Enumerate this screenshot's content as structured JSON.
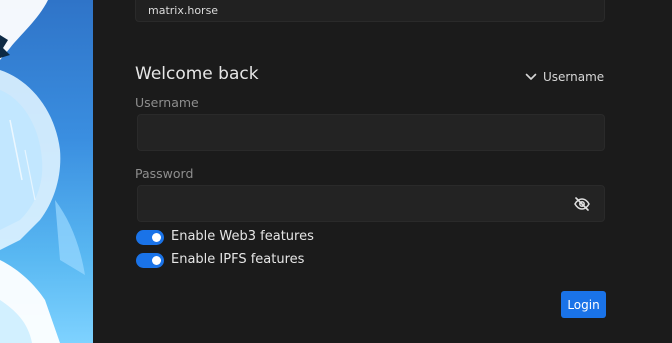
{
  "server": {
    "value": "matrix.horse"
  },
  "login": {
    "title": "Welcome back",
    "method_label": "Username",
    "username_label": "Username",
    "username_value": "",
    "password_label": "Password",
    "password_value": "",
    "toggles": [
      {
        "label": "Enable Web3 features",
        "enabled": true
      },
      {
        "label": "Enable IPFS features",
        "enabled": true
      }
    ],
    "submit_label": "Login"
  },
  "colors": {
    "accent": "#1a73e8",
    "background": "#1b1b1b",
    "field_background": "#232323"
  },
  "icons": {
    "method_dropdown": "chevron-down-icon",
    "password_visibility": "eye-off-icon"
  }
}
